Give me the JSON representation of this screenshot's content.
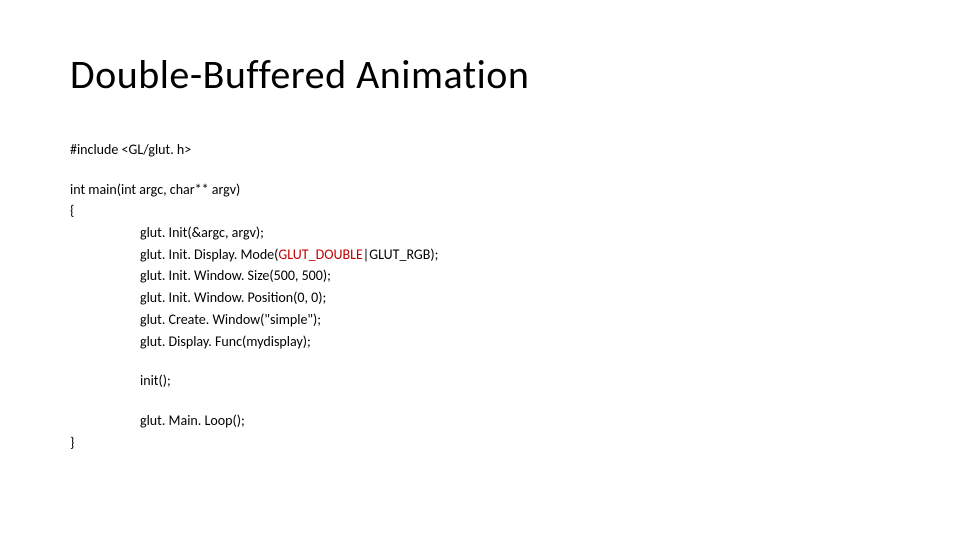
{
  "title": "Double-Buffered Animation",
  "code": {
    "include": "#include <GL/glut. h>",
    "main_sig": "int main(int argc, char** argv)",
    "open_brace": "{",
    "l1": "glut. Init(&argc, argv);",
    "l2a": "glut. Init. Display. Mode(",
    "l2b": "GLUT_DOUBLE",
    "l2c": "|GLUT_RGB);",
    "l3": "glut. Init. Window. Size(500, 500);",
    "l4": "glut. Init. Window. Position(0, 0);",
    "l5": "glut. Create. Window(\"simple\");",
    "l6": "glut. Display. Func(mydisplay);",
    "l7": "init();",
    "l8": "glut. Main. Loop();",
    "close_brace": "}"
  }
}
